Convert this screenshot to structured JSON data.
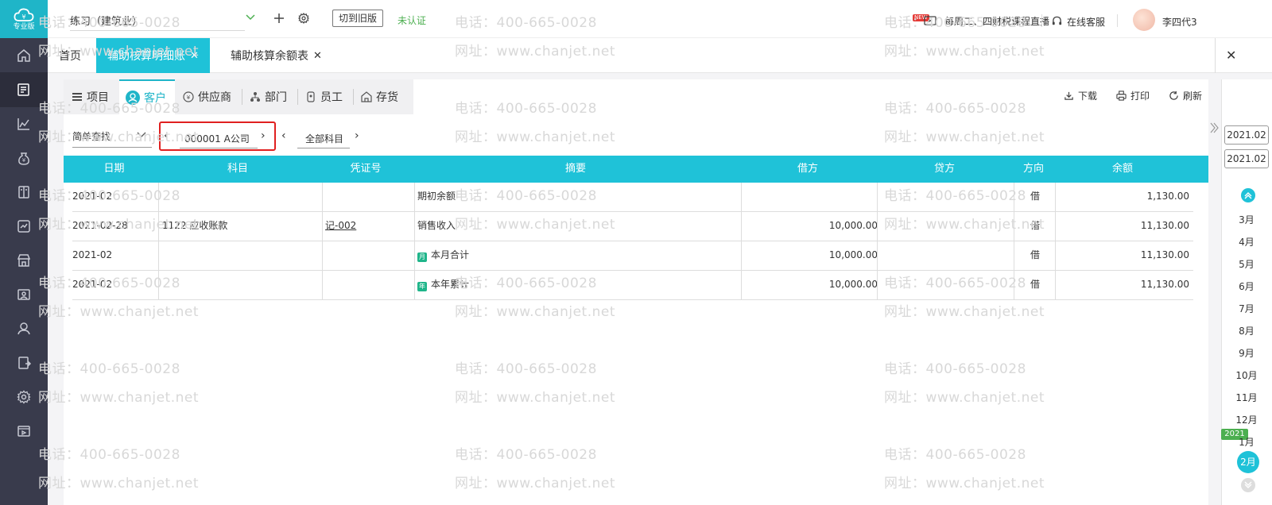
{
  "sidebar": {
    "logo_edition": "专业版",
    "items": [
      "home-icon",
      "voucher-icon",
      "chart-icon",
      "money-bag-icon",
      "book-icon",
      "report-icon",
      "store-icon",
      "asset-icon",
      "salary-icon",
      "invoice-icon",
      "gear-icon",
      "video-icon"
    ]
  },
  "topbar": {
    "account_set": "练习（建筑业）",
    "switch_old": "切到旧版",
    "cert_status": "未认证",
    "live_badge": "NEW",
    "live_text": "每周二、四财税课程直播",
    "service_text": "在线客服",
    "user_name": "李四代3"
  },
  "tabs": [
    {
      "label": "首页",
      "closable": false,
      "active": false
    },
    {
      "label": "辅助核算明细账",
      "closable": true,
      "active": true
    },
    {
      "label": "辅助核算余额表",
      "closable": true,
      "active": false
    }
  ],
  "close_all": "✕",
  "category_tabs": [
    "项目",
    "客户",
    "供应商",
    "部门",
    "员工",
    "存货"
  ],
  "toolbar": {
    "download": "下载",
    "print": "打印",
    "refresh": "刷新"
  },
  "filter": {
    "search_mode": "简单查找",
    "customer": "000001  A公司",
    "subject": "全部科目"
  },
  "table": {
    "headers": [
      "日期",
      "科目",
      "凭证号",
      "摘要",
      "借方",
      "贷方",
      "方向",
      "余额"
    ],
    "rows": [
      {
        "date": "2021-02",
        "subject": "",
        "voucher": "",
        "summary": "期初余额",
        "summary_icon": "",
        "debit": "",
        "credit": "",
        "direction": "借",
        "balance": "1,130.00"
      },
      {
        "date": "2021-02-28",
        "subject": "1122 应收账款",
        "voucher": "记-002",
        "summary": "销售收入",
        "summary_icon": "",
        "debit": "10,000.00",
        "credit": "",
        "direction": "借",
        "balance": "11,130.00"
      },
      {
        "date": "2021-02",
        "subject": "",
        "voucher": "",
        "summary": "本月合计",
        "summary_icon": "月",
        "debit": "10,000.00",
        "credit": "",
        "direction": "借",
        "balance": "11,130.00"
      },
      {
        "date": "2021-02",
        "subject": "",
        "voucher": "",
        "summary": "本年累计",
        "summary_icon": "年",
        "debit": "10,000.00",
        "credit": "",
        "direction": "借",
        "balance": "11,130.00"
      }
    ]
  },
  "period": {
    "start": "2021.02",
    "end": "2021.02"
  },
  "months": [
    "3月",
    "4月",
    "5月",
    "6月",
    "7月",
    "8月",
    "9月",
    "10月",
    "11月",
    "12月",
    "1月"
  ],
  "year_badge": "2021",
  "current_month": "2月",
  "watermark": {
    "phone": "电话：400-665-0028",
    "site": "网址：www.chanjet.net"
  },
  "colors": {
    "accent": "#1fc2d8",
    "sidebar": "#393b4c",
    "highlight_box": "#e02020",
    "cert": "#4caf50"
  }
}
